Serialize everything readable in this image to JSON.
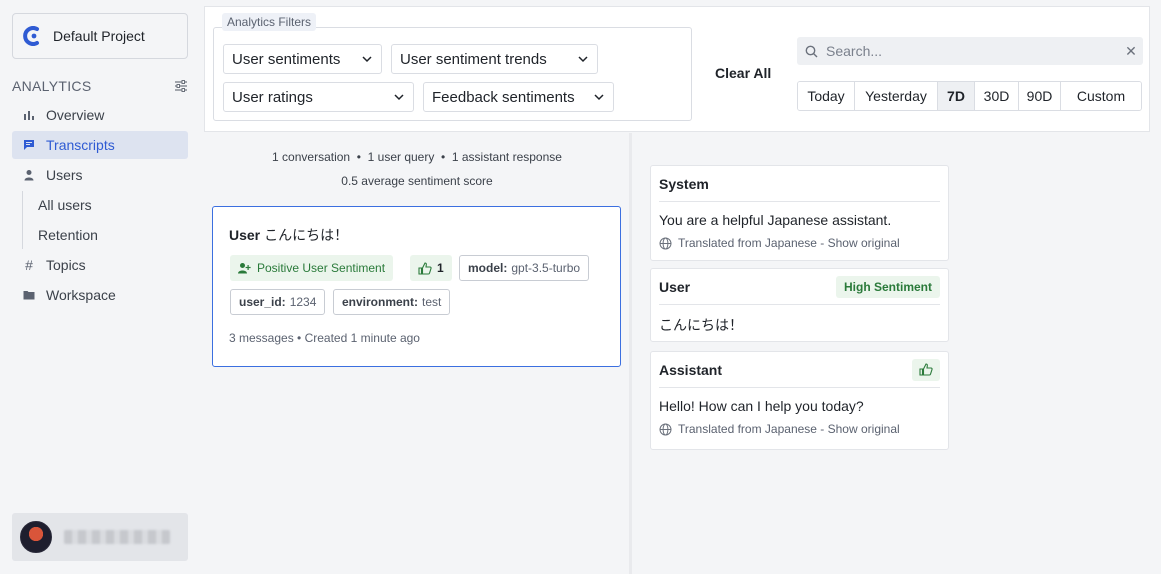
{
  "sidebar": {
    "project_name": "Default Project",
    "section_title": "ANALYTICS",
    "items": [
      {
        "label": "Overview",
        "icon": "bar-chart-icon"
      },
      {
        "label": "Transcripts",
        "icon": "chat-icon",
        "active": true
      },
      {
        "label": "Users",
        "icon": "user-icon"
      },
      {
        "label": "All users"
      },
      {
        "label": "Retention"
      },
      {
        "label": "Topics",
        "icon": "hash-icon"
      },
      {
        "label": "Workspace",
        "icon": "folder-icon"
      }
    ]
  },
  "filters": {
    "legend": "Analytics Filters",
    "dropdowns": [
      "User sentiments",
      "User sentiment trends",
      "User ratings",
      "Feedback sentiments"
    ],
    "clear_all": "Clear All",
    "search_placeholder": "Search...",
    "ranges": [
      "Today",
      "Yesterday",
      "7D",
      "30D",
      "90D",
      "Custom"
    ],
    "selected_range": "7D"
  },
  "summary": {
    "line1": "1 conversation  •  1 user query  •  1 assistant response",
    "line2": "0.5 average sentiment score"
  },
  "conversation": {
    "speaker": "User",
    "text": "こんにちは！",
    "sentiment_tag": "Positive User Sentiment",
    "like_count": "1",
    "model_key": "model:",
    "model_val": "gpt-3.5-turbo",
    "user_id_key": "user_id:",
    "user_id_val": "1234",
    "env_key": "environment:",
    "env_val": "test",
    "meta": "3 messages • Created 1 minute ago"
  },
  "messages": {
    "system": {
      "role": "System",
      "text": "You are a helpful Japanese assistant.",
      "translated": "Translated from Japanese - Show original"
    },
    "user": {
      "role": "User",
      "badge": "High Sentiment",
      "text": "こんにちは！"
    },
    "assistant": {
      "role": "Assistant",
      "text": "Hello! How can I help you today?",
      "translated": "Translated from Japanese - Show original"
    }
  },
  "colors": {
    "accent": "#2f5bd3",
    "positive": "#2a7a3a",
    "positive_bg": "#ebf5ec",
    "card_border": "#3b6fe0"
  }
}
